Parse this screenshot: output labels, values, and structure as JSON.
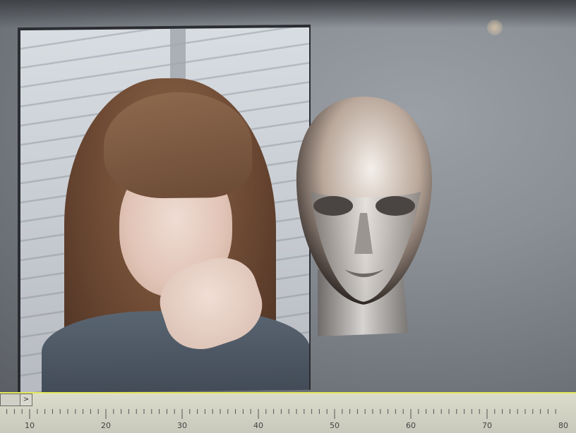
{
  "viewer": {
    "title": "",
    "photo": {
      "kind": "portrait-photo"
    },
    "model": {
      "kind": "3d-head-mesh"
    }
  },
  "timeline": {
    "scroll_arrow": ">",
    "ticks": [
      "10",
      "20",
      "30",
      "40",
      "50",
      "60",
      "70",
      "80"
    ]
  },
  "colors": {
    "viewport_bg": "#8a8f95",
    "timeline_bg": "#d6d6c8",
    "accent_line": "#e6e85a"
  }
}
